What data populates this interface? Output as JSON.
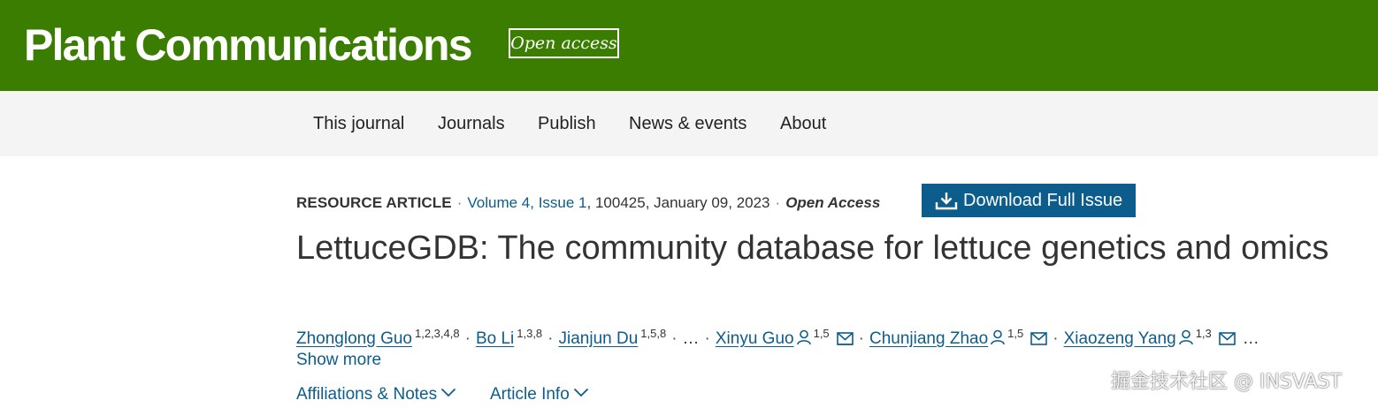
{
  "header": {
    "journal_name": "Plant Communications",
    "badge": "Open access",
    "background_color": "#3a7d00"
  },
  "nav": {
    "items": [
      {
        "label": "This journal"
      },
      {
        "label": "Journals"
      },
      {
        "label": "Publish"
      },
      {
        "label": "News & events"
      },
      {
        "label": "About"
      }
    ]
  },
  "article": {
    "type": "RESOURCE ARTICLE",
    "issue_link": "Volume 4, Issue 1",
    "citation": ", 100425, January 09, 2023",
    "access": "Open Access",
    "download_button": "Download Full Issue",
    "download_icon": "download-icon",
    "title": "LettuceGDB: The community database for lettuce genetics and omics",
    "link_color": "#0c5d8c",
    "authors": [
      {
        "name": "Zhonglong Guo",
        "affil": "1,2,3,4,8"
      },
      {
        "name": "Bo Li",
        "affil": "1,3,8"
      },
      {
        "name": "Jianjun Du",
        "affil": "1,5,8"
      },
      {
        "name": "Xinyu Guo",
        "affil": "1,5",
        "person_icon": "person-icon",
        "mail_icon": "mail-icon"
      },
      {
        "name": "Chunjiang Zhao",
        "affil": "1,5",
        "person_icon": "person-icon",
        "mail_icon": "mail-icon"
      },
      {
        "name": "Xiaozeng Yang",
        "affil": "1,3",
        "person_icon": "person-icon",
        "mail_icon": "mail-icon"
      }
    ],
    "ellipsis": "…",
    "show_more": "Show more",
    "affiliations_toggle": "Affiliations & Notes",
    "article_info_toggle": "Article Info"
  },
  "watermark": "掘金技术社区 @ INSVAST"
}
